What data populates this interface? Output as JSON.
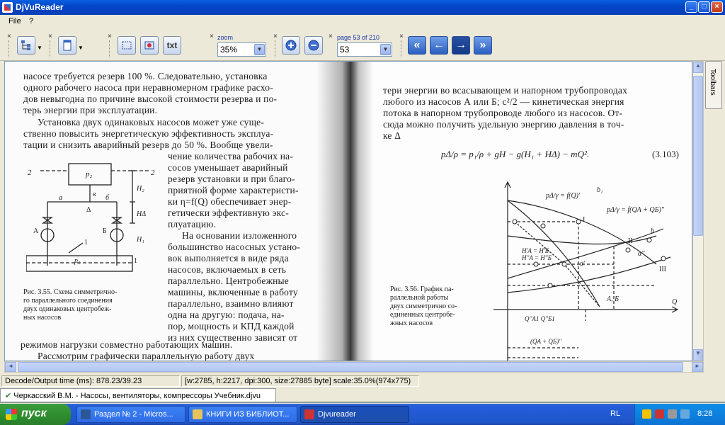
{
  "window": {
    "title": "DjVuReader",
    "controls": {
      "minimize": "_",
      "maximize": "□",
      "close": "×"
    }
  },
  "menu": {
    "file": "File",
    "help": "?"
  },
  "toolbar": {
    "zoom_label": "zoom",
    "zoom_value": "35%",
    "page_label": "page 53 of 210",
    "page_value": "53",
    "view_text_label": "txt",
    "close_glyph": "×"
  },
  "side_tab": {
    "label": "Toolbars"
  },
  "document": {
    "left_page": {
      "lines": [
        "насосе требуется резерв 100 %. Следовательно, установка",
        "одного рабочего насоса при неравномерном графике расхо-",
        "дов невыгодна по причине высокой стоимости резерва и по-",
        "терь энергии при эксплуатации.",
        "Установка двух одинаковых насосов может уже суще-",
        "ственно повысить энергетическую эффективность эксплуа-",
        "тации и снизить аварийный резерв до 50 %. Вообще увели-",
        "чение количества рабочих на-",
        "сосов уменьшает аварийный",
        "резерв установки и при благо-",
        "приятной форме характеристи-",
        "ки η=f(Q) обеспечивает энер-",
        "гетически эффективную экс-",
        "плуатацию.",
        "На основании изложенного",
        "большинство насосных устано-",
        "вок выполняется в виде ряда",
        "насосов, включаемых в сеть",
        "параллельно. Центробежные",
        "машины, включенные в работу",
        "параллельно, взаимно влияют",
        "одна на другую: подача, на-",
        "пор, мощность и КПД каждой",
        "из них существенно зависят от",
        "режимов нагрузки совместно работающих машин.",
        "Рассмотрим графически параллельную работу двух"
      ],
      "caption": [
        "Рис. 3.55. Схема симметрично-",
        "го параллельного соединения",
        "двух одинаковых центробеж-",
        "ных насосов"
      ],
      "diagram_labels": {
        "top_left": "2",
        "top_right": "2",
        "p2": "p₂",
        "v": "в",
        "h2": "H₂",
        "a": "а",
        "b": "б",
        "delta": "Δ",
        "hd": "HΔ",
        "h1": "H₁",
        "pump_a": "А",
        "pump_b": "Б",
        "one_top": "1",
        "p1": "p₁",
        "one_left": "1",
        "one_right": "1"
      }
    },
    "right_page": {
      "lines": [
        "тери энергии во всасывающем и напорном трубопроводах",
        "любого из насосов А или Б; c²/2 — кинетическая энергия",
        "потока в напорном трубопроводе любого из насосов. От-",
        "сюда можно получить удельную энергию давления в точ-",
        "ке Δ"
      ],
      "formula": "pΔ/ρ = p₁/ρ + gH − g(H₁ + HΔ) − mQ².",
      "equation_number": "(3.103)",
      "caption": [
        "Рис. 3.56. График па-",
        "раллельной работы",
        "двух симметрично со-",
        "единенных центробе-",
        "жных насосов"
      ],
      "graph_labels": {
        "curve_a": "pΔ/γ = f(Q)'",
        "b1": "b₁",
        "curve_b": "pΔ/γ = f(QA + QБ)''",
        "I": "I",
        "II": "II",
        "III": "III",
        "b": "b",
        "alpha_pp": "α''",
        "alpha_p": "α'",
        "AB": "A, Б",
        "Q": "Q",
        "HA": "H'A = H'Б",
        "HA2": "H''A = H''Б",
        "QA1": "Q''A1 Q''Б1",
        "bottom": "(QA + QБ)''"
      }
    }
  },
  "status": {
    "decode_time": "Decode/Output time (ms): 878.23/39.23",
    "info": "[w:2785, h:2217, dpi:300, size:27885 byte] scale:35.0%(974x775)"
  },
  "file_tab": {
    "label": "Черкасский В.М. - Насосы, вентиляторы, компрессоры Учебник.djvu"
  },
  "taskbar": {
    "start": "пуск",
    "tasks": [
      {
        "label": "Раздел № 2 - Micros...",
        "color": "#2b5797"
      },
      {
        "label": "КНИГИ ИЗ БИБЛИОТ...",
        "color": "#e8c25a"
      },
      {
        "label": "Djvureader",
        "color": "#c33"
      }
    ],
    "language": "RL",
    "clock": "8:28"
  }
}
